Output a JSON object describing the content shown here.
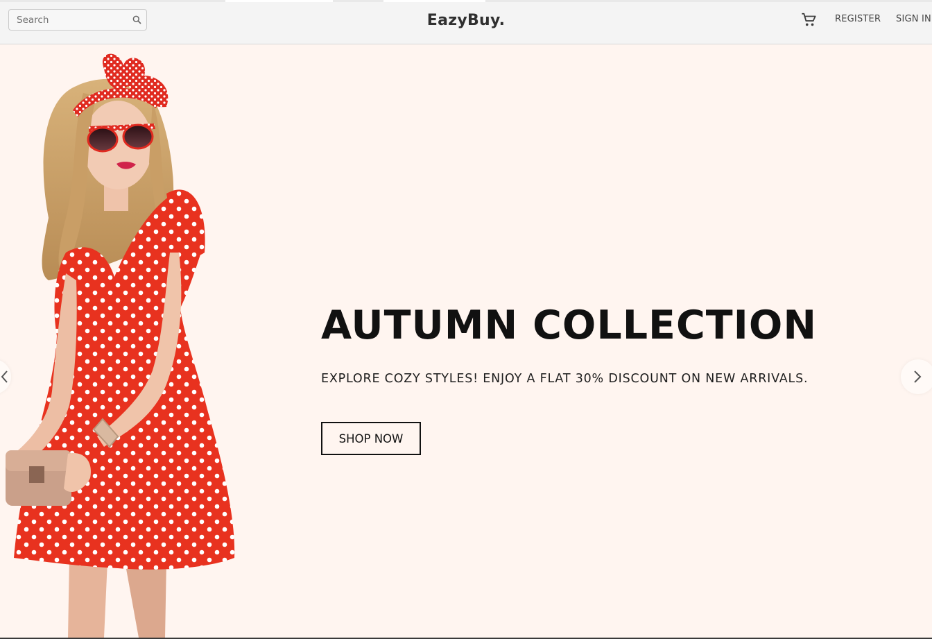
{
  "header": {
    "search_placeholder": "Search",
    "logo": "EazyBuy.",
    "register": "REGISTER",
    "sign_in": "SIGN IN",
    "icons": [
      "search-icon",
      "cart-icon"
    ]
  },
  "hero": {
    "title": "AUTUMN COLLECTION",
    "subtitle": "EXPLORE COZY STYLES! ENJOY A FLAT 30% DISCOUNT ON NEW ARRIVALS.",
    "cta": "SHOP NOW",
    "controls": [
      "chevron-left-icon",
      "chevron-right-icon"
    ]
  },
  "colors": {
    "hero_background": "#fff5f0",
    "header_background": "#f4f4f4",
    "dress_red": "#e8321f"
  }
}
